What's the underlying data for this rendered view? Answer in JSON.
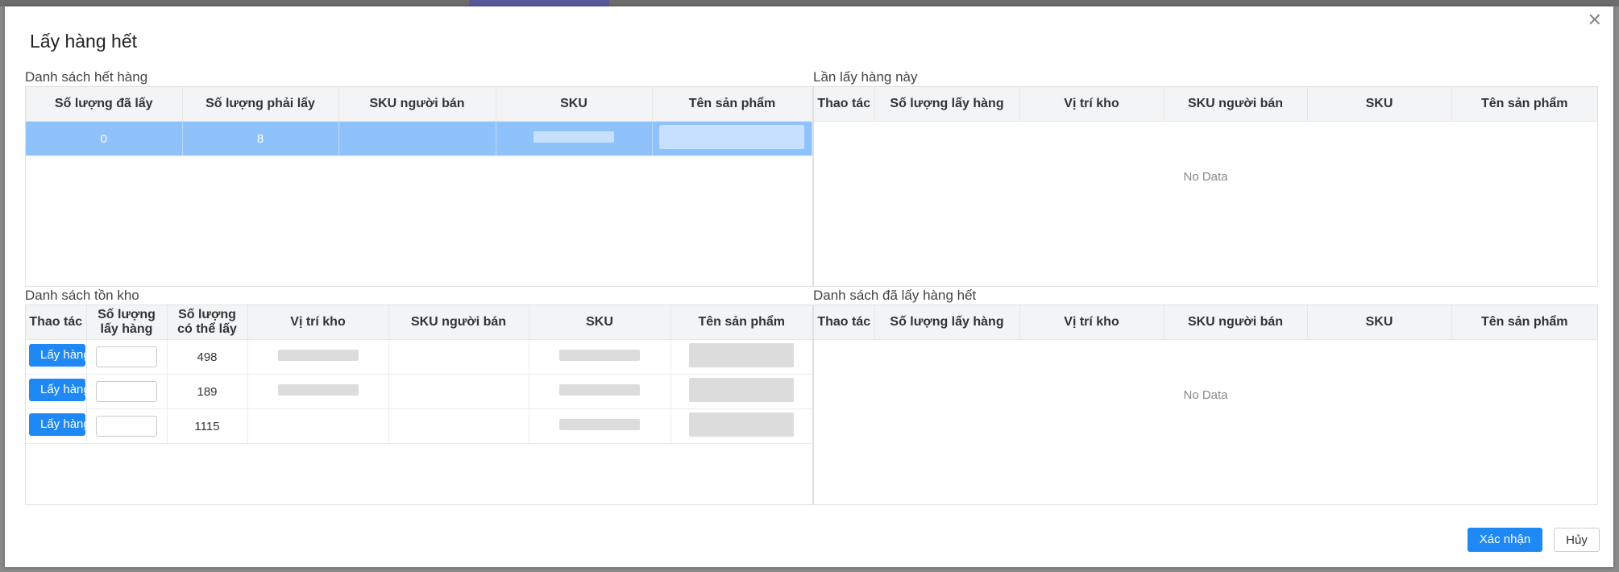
{
  "dialog": {
    "title": "Lấy hàng hết",
    "close_icon": "close-icon",
    "confirm_label": "Xác nhận",
    "cancel_label": "Hủy"
  },
  "out_of_stock": {
    "title": "Danh sách hết hàng",
    "columns": [
      "Số lượng đã lấy",
      "Số lượng phải lấy",
      "SKU người bán",
      "SKU",
      "Tên sản phẩm"
    ],
    "rows": [
      {
        "picked": "0",
        "required": "8",
        "seller_sku": "",
        "sku": "",
        "name": ""
      }
    ]
  },
  "this_pick": {
    "title": "Lần lấy hàng này",
    "columns": [
      "Thao tác",
      "Số lượng lấy hàng",
      "Vị trí kho",
      "SKU người bán",
      "SKU",
      "Tên sản phẩm"
    ],
    "empty_text": "No Data"
  },
  "inventory": {
    "title": "Danh sách tồn kho",
    "columns": [
      "Thao tác",
      "Số lượng lấy hàng",
      "Số lượng có thể lấy",
      "Vị trí kho",
      "SKU người bán",
      "SKU",
      "Tên sản phẩm"
    ],
    "action_label": "Lấy hàng",
    "rows": [
      {
        "available": "498",
        "location": "",
        "seller_sku": "",
        "sku": "",
        "name": ""
      },
      {
        "available": "189",
        "location": "",
        "seller_sku": "",
        "sku": "",
        "name": ""
      },
      {
        "available": "1115",
        "location": "",
        "seller_sku": "",
        "sku": "",
        "name": ""
      }
    ]
  },
  "picked_out": {
    "title": "Danh sách đã lấy hàng hết",
    "columns": [
      "Thao tác",
      "Số lượng lấy hàng",
      "Vị trí kho",
      "SKU người bán",
      "SKU",
      "Tên sản phẩm"
    ],
    "empty_text": "No Data"
  },
  "colors": {
    "primary": "#1e88f5",
    "selected_row": "#8fc2fb",
    "header_bg": "#f3f4f6"
  }
}
